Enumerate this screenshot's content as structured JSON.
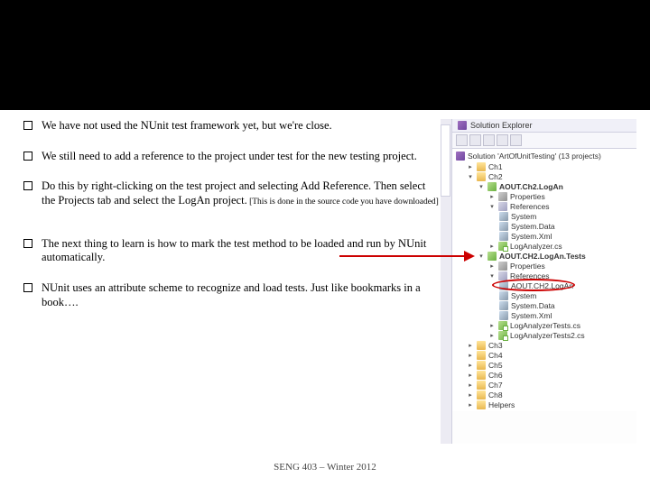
{
  "bullets": [
    {
      "text": "We have not used the NUnit test framework yet, but we're close."
    },
    {
      "text": "We still need to add a reference to the project under test for the new testing project."
    },
    {
      "text": "Do this by right-clicking on the test project and selecting Add Reference. Then select the Projects tab and select the LogAn project.",
      "note": " [This is done in the source code you have downloaded]"
    },
    {
      "text": "The next thing to learn is how to mark the test method to be loaded and run by NUnit automatically."
    },
    {
      "text": "NUnit uses an attribute scheme to recognize and load tests. Just like bookmarks in a book…."
    }
  ],
  "footer": "SENG 403 – Winter 2012",
  "explorer": {
    "title": "Solution Explorer",
    "solution": "Solution 'ArtOfUnitTesting' (13 projects)",
    "folders_above": [
      "Ch1",
      "Ch2"
    ],
    "proj_a": {
      "name": "AOUT.Ch2.LogAn",
      "properties": "Properties",
      "references": "References",
      "files": [
        "LogAnalyzer.cs"
      ]
    },
    "proj_b": {
      "name": "AOUT.CH2.LogAn.Tests",
      "properties": "Properties",
      "references": "References",
      "refs": [
        "System",
        "System.Data",
        "System.Xml"
      ],
      "test_refs": [
        "AOUT.CH2.LogAn",
        "System",
        "System.Data",
        "System.Xml"
      ],
      "files": [
        "LogAnalyzerTests.cs",
        "LogAnalyzerTests2.cs"
      ]
    },
    "folders_below": [
      "Ch3",
      "Ch4",
      "Ch5",
      "Ch6",
      "Ch7",
      "Ch8",
      "Helpers"
    ]
  }
}
